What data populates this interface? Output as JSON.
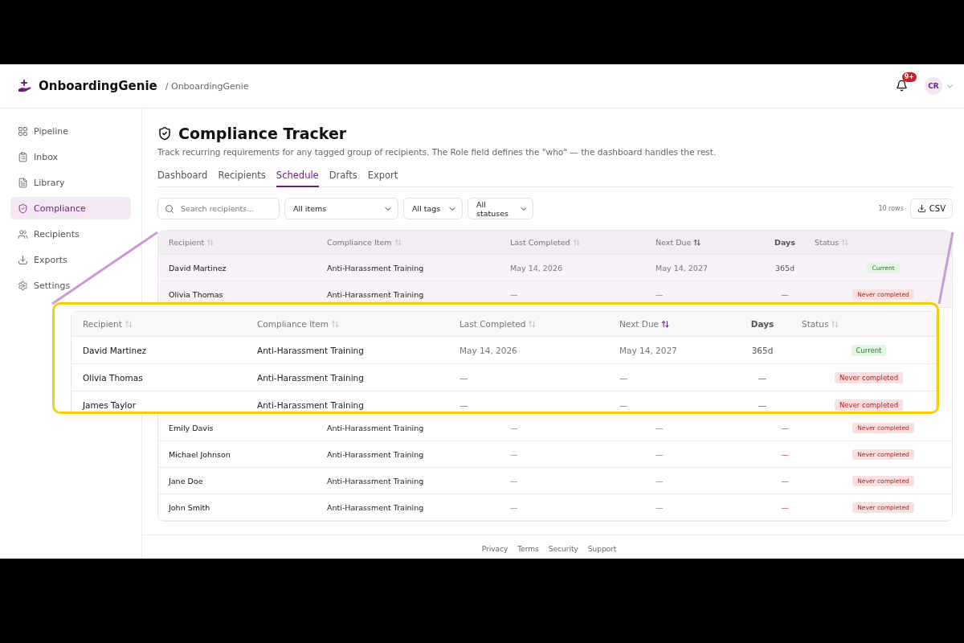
{
  "app": {
    "name": "OnboardingGenie",
    "breadcrumb": "/ OnboardingGenie"
  },
  "header": {
    "notification_badge": "9+",
    "avatar": "CR"
  },
  "sidebar": {
    "items": [
      {
        "label": "Pipeline",
        "selected": false
      },
      {
        "label": "Inbox",
        "selected": false
      },
      {
        "label": "Library",
        "selected": false
      },
      {
        "label": "Compliance",
        "selected": true
      },
      {
        "label": "Recipients",
        "selected": false
      },
      {
        "label": "Exports",
        "selected": false
      },
      {
        "label": "Settings",
        "selected": false
      }
    ]
  },
  "page": {
    "title": "Compliance Tracker",
    "description": "Track recurring requirements for any tagged group of recipients. The Role field defines the \"who\" — the dashboard handles the rest."
  },
  "tabs": [
    {
      "label": "Dashboard",
      "selected": false
    },
    {
      "label": "Recipients",
      "selected": false
    },
    {
      "label": "Schedule",
      "selected": true
    },
    {
      "label": "Drafts",
      "selected": false
    },
    {
      "label": "Export",
      "selected": false
    }
  ],
  "filters": {
    "search_placeholder": "Search recipients...",
    "selects": [
      "All items",
      "All tags",
      "All statuses"
    ],
    "row_count": "10 rows",
    "csv_button": "CSV"
  },
  "table": {
    "columns": [
      {
        "label": "Recipient",
        "sortable": true,
        "sorted": false
      },
      {
        "label": "Compliance Item",
        "sortable": true,
        "sorted": false
      },
      {
        "label": "Last Completed",
        "sortable": true,
        "sorted": false
      },
      {
        "label": "Next Due",
        "sortable": true,
        "sorted": true
      },
      {
        "label": "Days",
        "sortable": false
      },
      {
        "label": "Status",
        "sortable": true,
        "sorted": false
      }
    ],
    "rows": [
      {
        "highlighted": true,
        "recipient": "David Martinez",
        "item": "Anti-Harassment Training",
        "last_completed": "May 14, 2026",
        "next_due": "May 14, 2027",
        "days": "365d",
        "status": {
          "label": "Current",
          "kind": "current"
        }
      },
      {
        "highlighted": true,
        "recipient": "Olivia Thomas",
        "item": "Anti-Harassment Training",
        "last_completed": "—",
        "next_due": "—",
        "days": "—",
        "status": {
          "label": "Never completed",
          "kind": "never"
        }
      },
      {
        "highlighted": false,
        "recipient": "Emily Davis",
        "item": "Anti-Harassment Training",
        "last_completed": "—",
        "next_due": "—",
        "days": "—",
        "status": {
          "label": "Never completed",
          "kind": "never"
        }
      },
      {
        "highlighted": false,
        "recipient": "Michael Johnson",
        "item": "Anti-Harassment Training",
        "last_completed": "—",
        "next_due": "—",
        "days": "—",
        "status": {
          "label": "Never completed",
          "kind": "never"
        }
      },
      {
        "highlighted": false,
        "recipient": "Jane Doe",
        "item": "Anti-Harassment Training",
        "last_completed": "—",
        "next_due": "—",
        "days": "—",
        "status": {
          "label": "Never completed",
          "kind": "never"
        }
      },
      {
        "highlighted": false,
        "recipient": "John Smith",
        "item": "Anti-Harassment Training",
        "last_completed": "—",
        "next_due": "—",
        "days": "—",
        "status": {
          "label": "Never completed",
          "kind": "never"
        }
      }
    ]
  },
  "callout": {
    "columns": [
      {
        "label": "Recipient",
        "sortable": true,
        "sorted": false
      },
      {
        "label": "Compliance Item",
        "sortable": true,
        "sorted": false
      },
      {
        "label": "Last Completed",
        "sortable": true,
        "sorted": false
      },
      {
        "label": "Next Due",
        "sortable": true,
        "sorted": true
      },
      {
        "label": "Days",
        "sortable": false
      },
      {
        "label": "Status",
        "sortable": true,
        "sorted": false
      }
    ],
    "rows": [
      {
        "recipient": "David Martinez",
        "item": "Anti-Harassment Training",
        "last_completed": "May 14, 2026",
        "next_due": "May 14, 2027",
        "days": "365d",
        "status": {
          "label": "Current",
          "kind": "current"
        }
      },
      {
        "recipient": "Olivia Thomas",
        "item": "Anti-Harassment Training",
        "last_completed": "—",
        "next_due": "—",
        "days": "—",
        "status": {
          "label": "Never completed",
          "kind": "never"
        }
      },
      {
        "recipient": "James Taylor",
        "item": "Anti-Harassment Training",
        "last_completed": "—",
        "next_due": "—",
        "days": "—",
        "status": {
          "label": "Never completed",
          "kind": "never"
        }
      }
    ]
  },
  "footer": {
    "links": [
      "Privacy",
      "Terms",
      "Security",
      "Support"
    ]
  }
}
